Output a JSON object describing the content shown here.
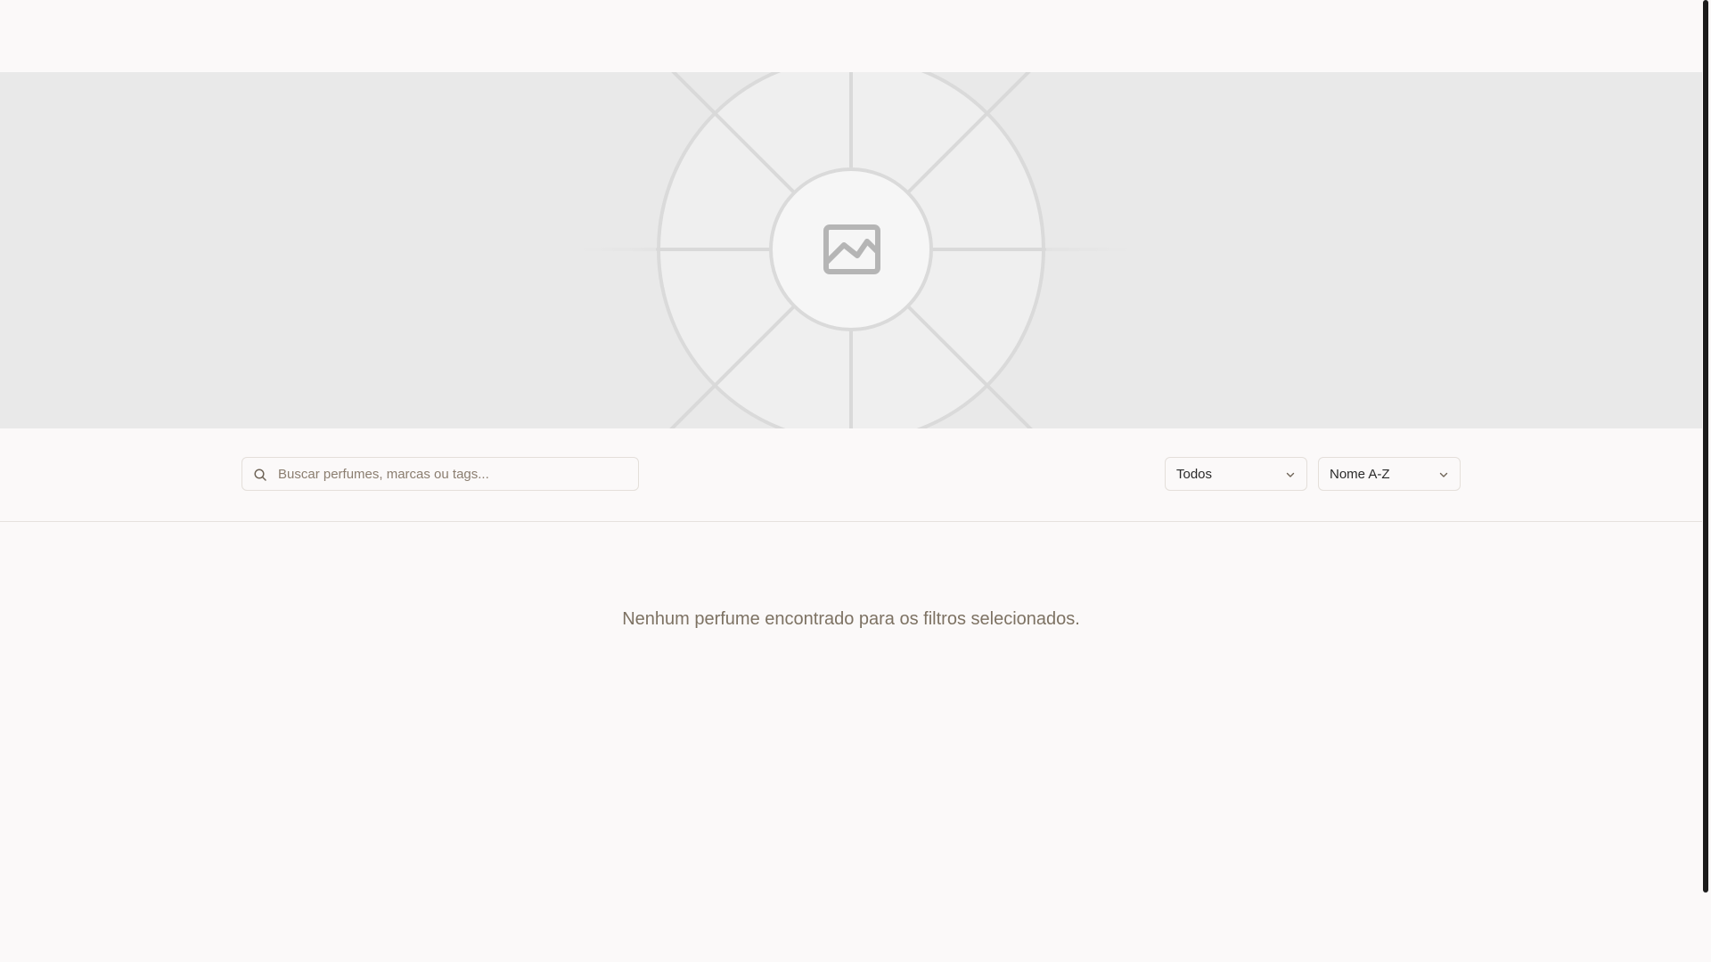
{
  "hero": {
    "image_icon": "image-placeholder-icon"
  },
  "filters": {
    "search": {
      "placeholder": "Buscar perfumes, marcas ou tags...",
      "value": "",
      "icon": "search-icon"
    },
    "category": {
      "selected": "Todos",
      "icon": "chevron-down-icon"
    },
    "sort": {
      "selected": "Nome A-Z",
      "icon": "chevron-down-icon"
    }
  },
  "results": {
    "empty_message": "Nenhum perfume encontrado para os filtros selecionados."
  },
  "colors": {
    "background": "#fbf9f9",
    "hero_background": "#e9e9e9",
    "muted_text": "#7d7263",
    "border": "#e4dfda"
  }
}
